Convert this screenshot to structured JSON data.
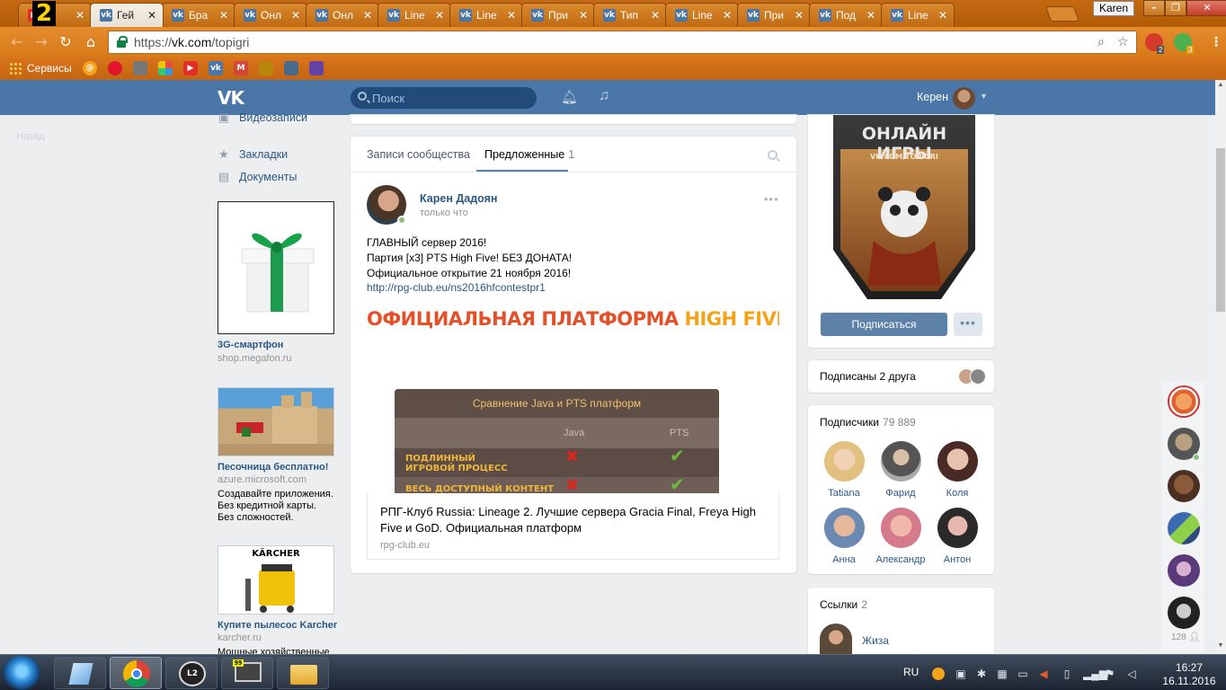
{
  "browser": {
    "tab_badge": "2",
    "tabs": [
      {
        "title": "K",
        "icon": "youtube-icon",
        "active": false
      },
      {
        "title": "Гей",
        "icon": "vk-icon",
        "active": true
      },
      {
        "title": "Бра",
        "icon": "vk-icon",
        "active": false
      },
      {
        "title": "Онл",
        "icon": "vk-icon",
        "active": false
      },
      {
        "title": "Онл",
        "icon": "vk-icon",
        "active": false
      },
      {
        "title": "Line",
        "icon": "vk-icon",
        "active": false
      },
      {
        "title": "Line",
        "icon": "vk-icon",
        "active": false
      },
      {
        "title": "При",
        "icon": "vk-icon",
        "active": false
      },
      {
        "title": "Тип",
        "icon": "vk-icon",
        "active": false
      },
      {
        "title": "Line",
        "icon": "vk-icon",
        "active": false
      },
      {
        "title": "При",
        "icon": "vk-icon",
        "active": false
      },
      {
        "title": "Под",
        "icon": "vk-icon",
        "active": false
      },
      {
        "title": "Line",
        "icon": "vk-icon",
        "active": false
      }
    ],
    "profile_name": "Karen",
    "url_proto": "https://",
    "url_host": "vk.com",
    "url_path": "/topigri",
    "ext_abp_badge": "2",
    "ext_green_badge": "3",
    "bookmarks_apps_label": "Сервисы"
  },
  "vk": {
    "search_placeholder": "Поиск",
    "user_name": "Керен",
    "left_nav": [
      {
        "label": "Видеозаписи",
        "icon": "video-icon"
      },
      {
        "label": "Закладки",
        "icon": "star-icon"
      },
      {
        "label": "Документы",
        "icon": "document-icon"
      }
    ],
    "faded_label": "Назад",
    "ads": [
      {
        "title": "3G-смартфон",
        "domain": "shop.megafon.ru",
        "text": []
      },
      {
        "title": "Песочница бесплатно!",
        "domain": "azure.microsoft.com",
        "text": [
          "Создавайте приложения.",
          "Без кредитной карты.",
          "Без сложностей."
        ]
      },
      {
        "title": "Купите пылесос Karcher",
        "domain": "karcher.ru",
        "text": [
          "Мощные хозяйственные"
        ],
        "brand": "KÄRCHER"
      }
    ],
    "wall": {
      "tab_posts": "Записи сообщества",
      "tab_suggested": "Предложенные",
      "suggested_count": "1"
    },
    "post": {
      "author": "Карен Дадоян",
      "time": "только что",
      "lines": [
        "ГЛАВНЫЙ сервер 2016!",
        "Партия [x3] PTS High Five! БЕЗ ДОНАТА!",
        "Официальное открытие 21 ноября 2016!"
      ],
      "link": "http://rpg-club.eu/ns2016hfcontestpr1",
      "banner_head_a": "ОФИЦИАЛЬНАЯ ПЛАТФОРМА",
      "banner_head_b": "HIGH FIVE",
      "table_title": "Сравнение Java и PTS платформ",
      "col_java": "Java",
      "col_pts": "PTS",
      "row1_a": "ПОДЛИННЫЙ",
      "row1_b": "ИГРОВОЙ ПРОЦЕСС",
      "row2": "ВЕСЬ ДОСТУПНЫЙ КОНТЕНТ",
      "snippet_title": "РПГ-Клуб Russia: Lineage 2. Лучшие сервера Gracia Final, Freya High Five и GoD. Официальная платформ",
      "snippet_domain": "rpg-club.eu"
    },
    "community": {
      "cover_title": "ОНЛАЙН ИГРЫ",
      "cover_sub": "VK.COM/TOPIGRI",
      "subscribe_label": "Подписаться",
      "friends_label": "Подписаны 2 друга",
      "followers_label": "Подписчики",
      "followers_count": "79 889",
      "followers": [
        {
          "name": "Tatiana"
        },
        {
          "name": "Фарид"
        },
        {
          "name": "Коля"
        },
        {
          "name": "Анна"
        },
        {
          "name": "Александр"
        },
        {
          "name": "Антон"
        }
      ],
      "links_label": "Ссылки",
      "links_count": "2",
      "link1": "Жиза"
    },
    "float_count": "128"
  },
  "taskbar": {
    "lang": "RU",
    "time": "16:27",
    "date": "16.11.2016"
  },
  "colors": {
    "vk_blue": "#4a76a8",
    "chrome_orange": "#d77a1a",
    "link": "#2a5885"
  }
}
